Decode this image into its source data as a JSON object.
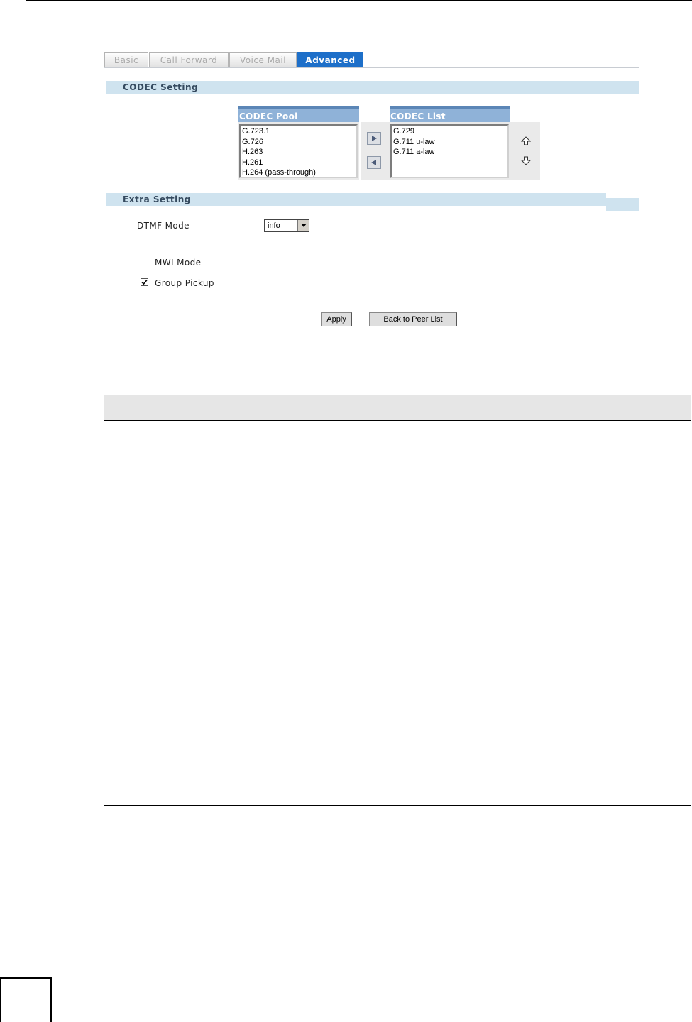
{
  "tabs": [
    {
      "label": "Basic",
      "active": false
    },
    {
      "label": "Call Forward",
      "active": false
    },
    {
      "label": "Voice Mail",
      "active": false
    },
    {
      "label": "Advanced",
      "active": true
    }
  ],
  "codec_setting": {
    "title": "CODEC Setting",
    "pool": {
      "title": "CODEC Pool",
      "items": [
        "G.723.1",
        "G.726",
        "H.263",
        "H.261",
        "H.264 (pass-through)"
      ]
    },
    "list": {
      "title": "CODEC List",
      "items": [
        "G.729",
        "G.711 u-law",
        "G.711 a-law"
      ]
    },
    "icons": {
      "add": "arrow-right-icon",
      "remove": "arrow-left-icon",
      "move_up": "arrow-up-icon",
      "move_down": "arrow-down-icon"
    }
  },
  "extra_setting": {
    "title": "Extra Setting",
    "dtmf_mode": {
      "label": "DTMF Mode",
      "value": "info"
    },
    "mwi_mode": {
      "label": "MWI Mode",
      "checked": false
    },
    "group_pickup": {
      "label": "Group Pickup",
      "checked": true
    }
  },
  "buttons": {
    "apply": "Apply",
    "back": "Back to Peer List"
  },
  "colors": {
    "active_tab": "#1d6fc9",
    "section_bar": "#cfe3ef",
    "list_title": "#8fb2d8"
  }
}
